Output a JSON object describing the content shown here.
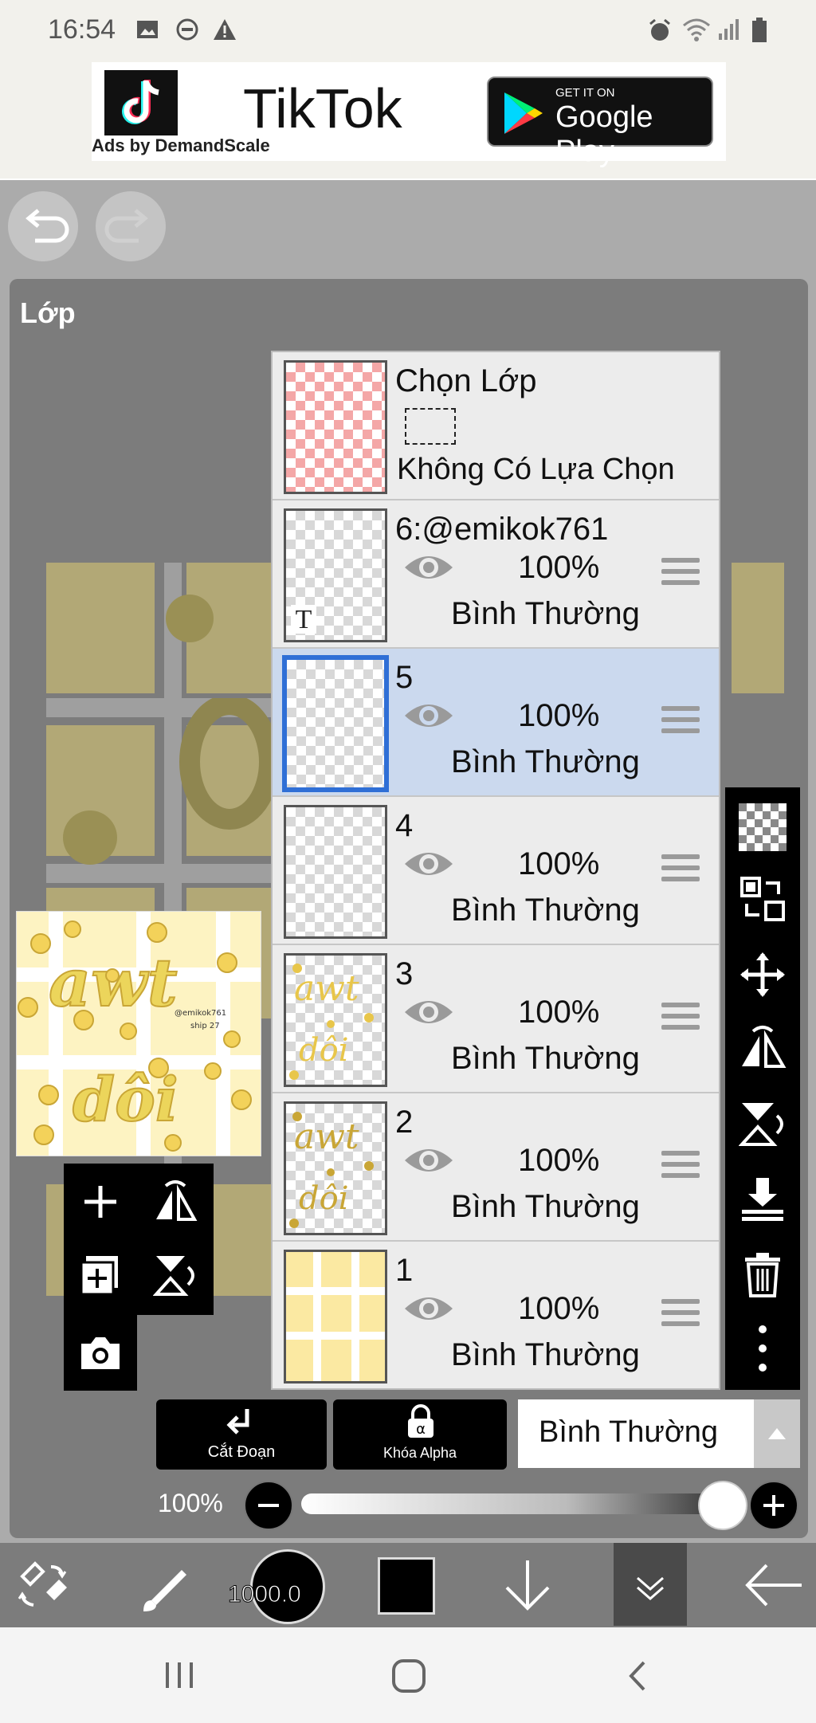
{
  "status_bar": {
    "time": "16:54"
  },
  "ad": {
    "title": "TikTok",
    "sub": "Ads by DemandScale",
    "store_small": "GET IT ON",
    "store_big": "Google Play"
  },
  "panel": {
    "title": "Lớp"
  },
  "selection_row": {
    "title": "Chọn Lớp",
    "status": "Không Có Lựa Chọn"
  },
  "layers": [
    {
      "name": "6:@emikok761",
      "opacity": "100%",
      "mode": "Bình Thường",
      "selected": false
    },
    {
      "name": "5",
      "opacity": "100%",
      "mode": "Bình Thường",
      "selected": true
    },
    {
      "name": "4",
      "opacity": "100%",
      "mode": "Bình Thường",
      "selected": false
    },
    {
      "name": "3",
      "opacity": "100%",
      "mode": "Bình Thường",
      "selected": false
    },
    {
      "name": "2",
      "opacity": "100%",
      "mode": "Bình Thường",
      "selected": false
    },
    {
      "name": "1",
      "opacity": "100%",
      "mode": "Bình Thường",
      "selected": false
    }
  ],
  "controls": {
    "clip_label": "Cắt Đoạn",
    "alpha_lock_label": "Khóa Alpha",
    "blend_mode": "Bình Thường",
    "opacity_label": "100%",
    "opacity_value": 1.0
  },
  "bottom": {
    "brush_size": "1000.0"
  },
  "colors": {
    "selected_layer_bg": "#cbd9ee",
    "accent": "#2f6fd6",
    "canvas_yellow": "#f5d66a"
  }
}
